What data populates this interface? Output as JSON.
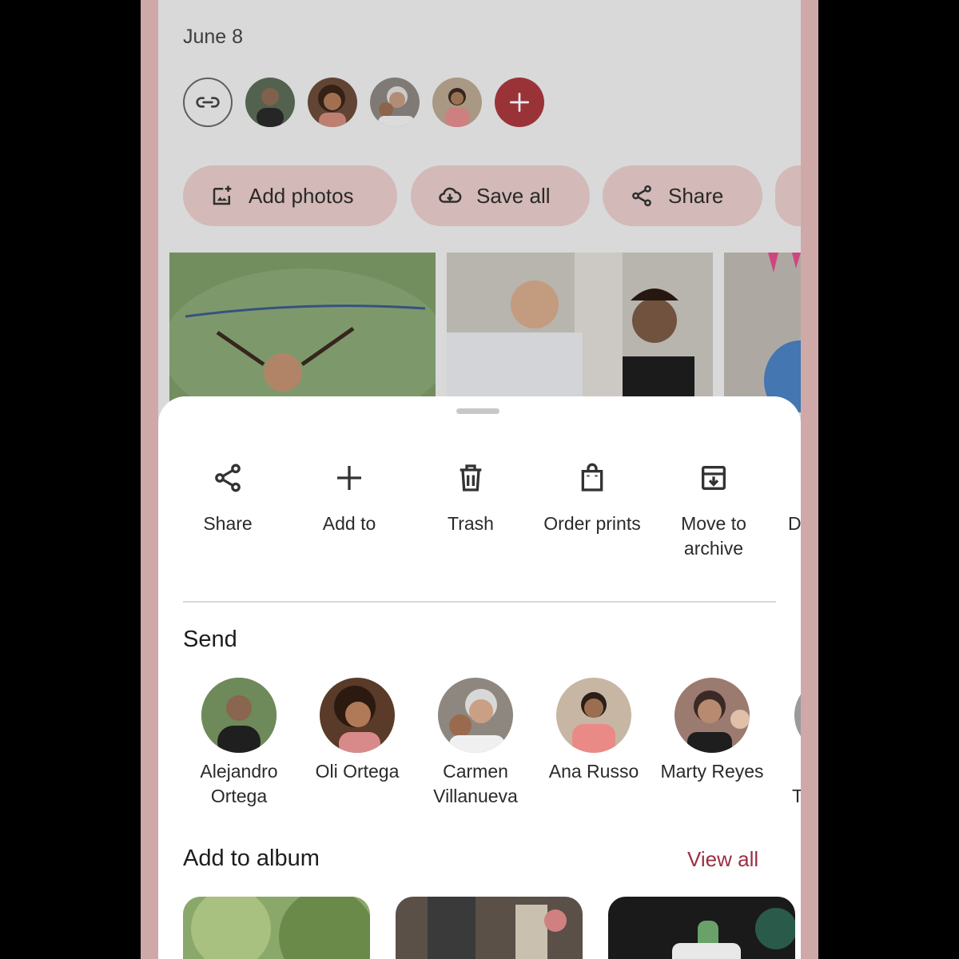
{
  "header": {
    "date": "June 8"
  },
  "share_row": {
    "people": [
      {
        "icon": "avatar-bald-man-icon",
        "bg": "#5a6b55"
      },
      {
        "icon": "avatar-curly-hair-icon",
        "bg": "#6b4a3a"
      },
      {
        "icon": "avatar-elderly-woman-icon",
        "bg": "#8a8580"
      },
      {
        "icon": "avatar-young-woman-icon",
        "bg": "#b8a58f"
      }
    ]
  },
  "chips": [
    {
      "label": "Add photos",
      "icon": "add-photo-icon"
    },
    {
      "label": "Save all",
      "icon": "cloud-download-icon"
    },
    {
      "label": "Share",
      "icon": "share-icon"
    }
  ],
  "actions": [
    {
      "label": "Share",
      "icon": "share-icon"
    },
    {
      "label": "Add to",
      "icon": "plus-icon"
    },
    {
      "label": "Trash",
      "icon": "trash-icon"
    },
    {
      "label": "Order prints",
      "icon": "shopping-bag-icon"
    },
    {
      "label": "Move to archive",
      "icon": "archive-icon"
    },
    {
      "label": "De",
      "icon": ""
    }
  ],
  "send": {
    "title": "Send",
    "contacts": [
      {
        "name": "Alejandro Ortega",
        "bg": "#4e6040"
      },
      {
        "name": "Oli Ortega",
        "bg": "#6a4530"
      },
      {
        "name": "Carmen Villanueva",
        "bg": "#8b8178"
      },
      {
        "name": "Ana Russo",
        "bg": "#c9a08e"
      },
      {
        "name": "Marty Reyes",
        "bg": "#7a5a50"
      },
      {
        "name": "T",
        "bg": "#9a9a9a"
      }
    ]
  },
  "album": {
    "title": "Add to album",
    "view_all": "View all"
  },
  "colors": {
    "accent": "#a8383d",
    "link": "#9c2f40",
    "chip": "#e5c9c7"
  }
}
